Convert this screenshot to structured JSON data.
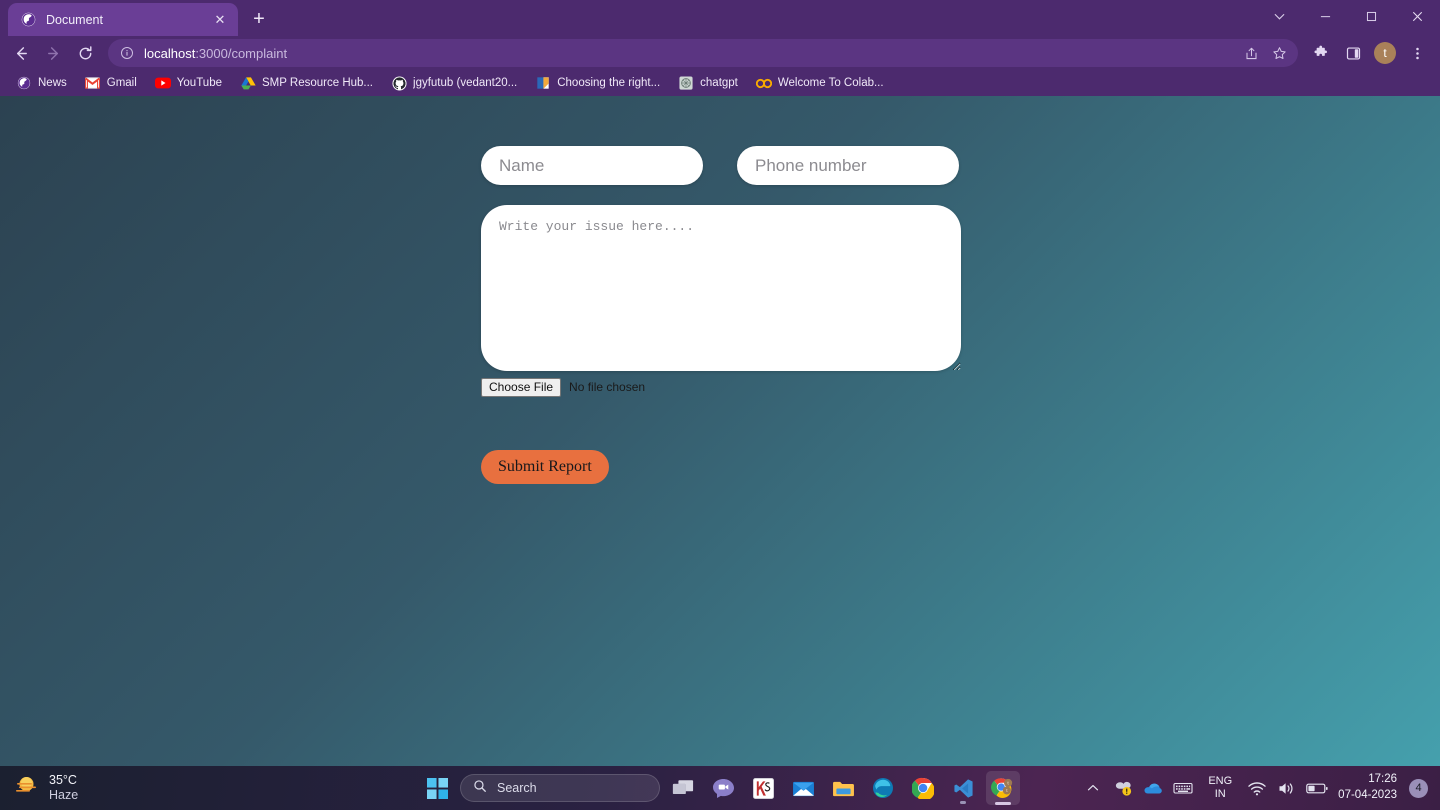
{
  "browser": {
    "tab": {
      "title": "Document",
      "favicon": "globe-icon",
      "close_label": "✕"
    },
    "new_tab_label": "+",
    "window_controls": [
      {
        "name": "tab-search",
        "glyph": "⌄"
      },
      {
        "name": "minimize",
        "glyph": "–"
      },
      {
        "name": "maximize",
        "glyph": "❐"
      },
      {
        "name": "close",
        "glyph": "✕"
      }
    ],
    "toolbar": {
      "back_label": "←",
      "forward_label": "→",
      "reload_label": "↻",
      "site_info_icon": "info-circle-icon",
      "url_host": "localhost",
      "url_path": ":3000/complaint",
      "share_icon": "share-icon",
      "bookmark_icon": "star-icon",
      "extensions_icon": "puzzle-icon",
      "side_panel_icon": "side-panel-icon",
      "profile_initial": "t",
      "menu_icon": "three-dot-menu-icon"
    },
    "bookmarks": [
      {
        "label": "News",
        "icon": "globe-icon"
      },
      {
        "label": "Gmail",
        "icon": "gmail-icon"
      },
      {
        "label": "YouTube",
        "icon": "youtube-icon"
      },
      {
        "label": "SMP Resource Hub...",
        "icon": "google-drive-icon"
      },
      {
        "label": "jgyfutub (vedant20...",
        "icon": "github-icon"
      },
      {
        "label": "Choosing the right...",
        "icon": "document-icon"
      },
      {
        "label": "chatgpt",
        "icon": "openai-icon"
      },
      {
        "label": "Welcome To Colab...",
        "icon": "colab-icon"
      }
    ]
  },
  "page": {
    "background_start": "#2c4251",
    "background_end": "#45a0ad",
    "name_placeholder": "Name",
    "name_value": "",
    "phone_placeholder": "Phone number",
    "phone_value": "",
    "issue_placeholder": "Write your issue here....",
    "issue_value": "",
    "choose_file_label": "Choose File",
    "file_status": "No file chosen",
    "submit_label": "Submit Report",
    "submit_color": "#e8703f"
  },
  "taskbar": {
    "weather": {
      "temperature": "35°C",
      "condition": "Haze",
      "icon": "haze-sun-icon"
    },
    "start_icon": "windows-start-icon",
    "search_placeholder": "Search",
    "search_icon": "search-icon",
    "apps": [
      {
        "name": "task-view",
        "state": "idle"
      },
      {
        "name": "chat-teams",
        "state": "idle"
      },
      {
        "name": "ks-app",
        "state": "idle"
      },
      {
        "name": "mail",
        "state": "idle"
      },
      {
        "name": "file-explorer",
        "state": "idle"
      },
      {
        "name": "microsoft-edge",
        "state": "idle"
      },
      {
        "name": "google-chrome",
        "state": "idle"
      },
      {
        "name": "vs-code",
        "state": "running"
      },
      {
        "name": "google-chrome-active",
        "state": "active"
      }
    ],
    "tray": {
      "chevron_icon": "chevron-up-icon",
      "security_icon": "security-warning-icon",
      "cloud_icon": "onedrive-cloud-icon",
      "keyboard_icon": "keyboard-icon",
      "language_primary": "ENG",
      "language_secondary": "IN",
      "wifi_icon": "wifi-icon",
      "volume_icon": "speaker-icon",
      "battery_icon": "battery-icon",
      "time": "17:26",
      "date": "07-04-2023",
      "notification_count": "4"
    }
  }
}
